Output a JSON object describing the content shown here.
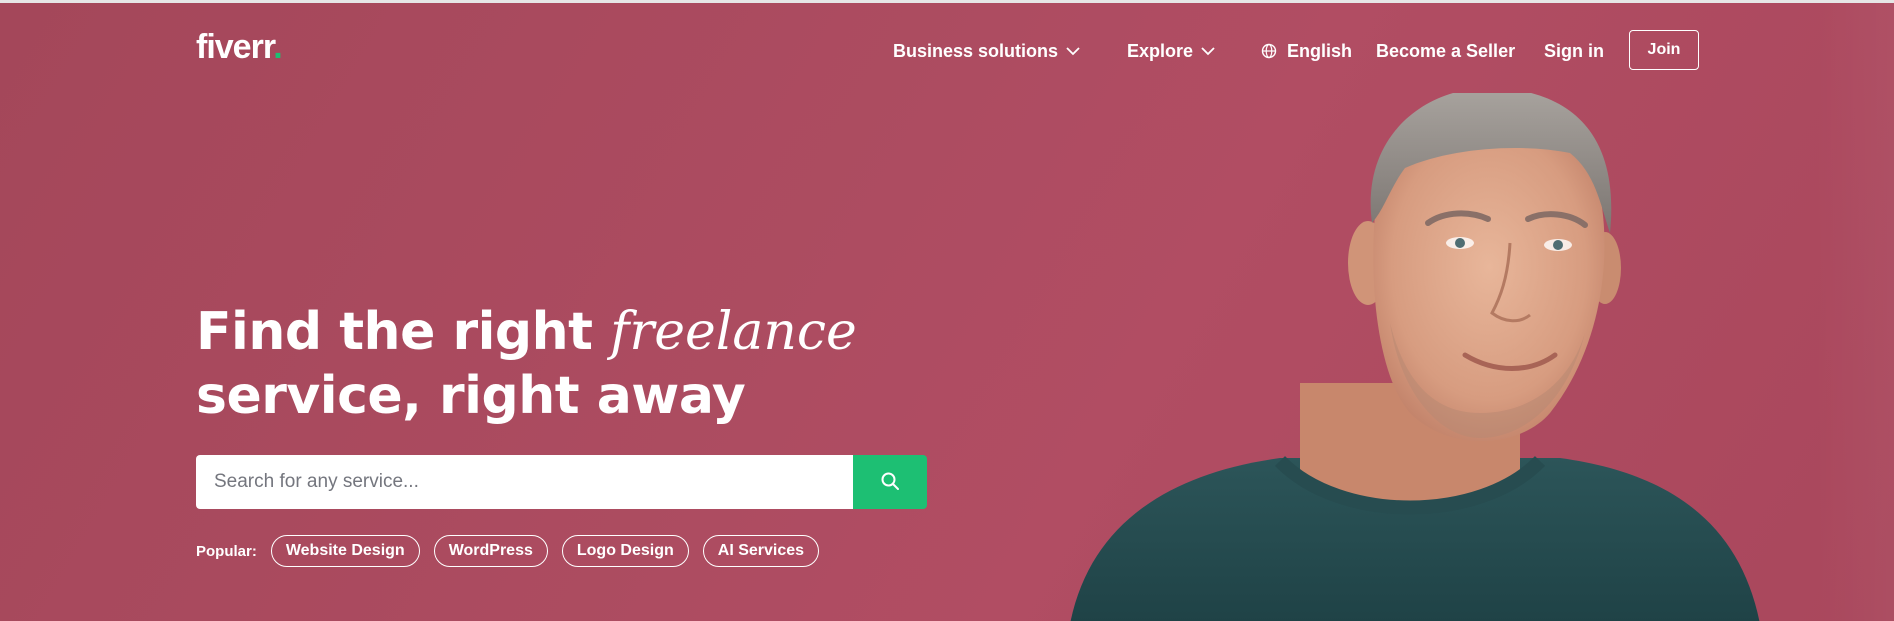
{
  "brand": {
    "logo_text": "fiverr",
    "logo_dot": ".",
    "accent": "#1dbf73",
    "hero_bg": "#ad4c61"
  },
  "nav": {
    "business_solutions": "Business solutions",
    "explore": "Explore",
    "language": "English",
    "become_seller": "Become a Seller",
    "sign_in": "Sign in",
    "join": "Join"
  },
  "hero": {
    "headline_part1": "Find the right ",
    "headline_italic": "freelance",
    "headline_line2": "service, right away"
  },
  "search": {
    "placeholder": "Search for any service..."
  },
  "popular": {
    "label": "Popular:",
    "tags": [
      "Website Design",
      "WordPress",
      "Logo Design",
      "AI Services"
    ]
  },
  "icons": {
    "chevron": "chevron-down-icon",
    "globe": "globe-icon",
    "search": "search-icon"
  }
}
